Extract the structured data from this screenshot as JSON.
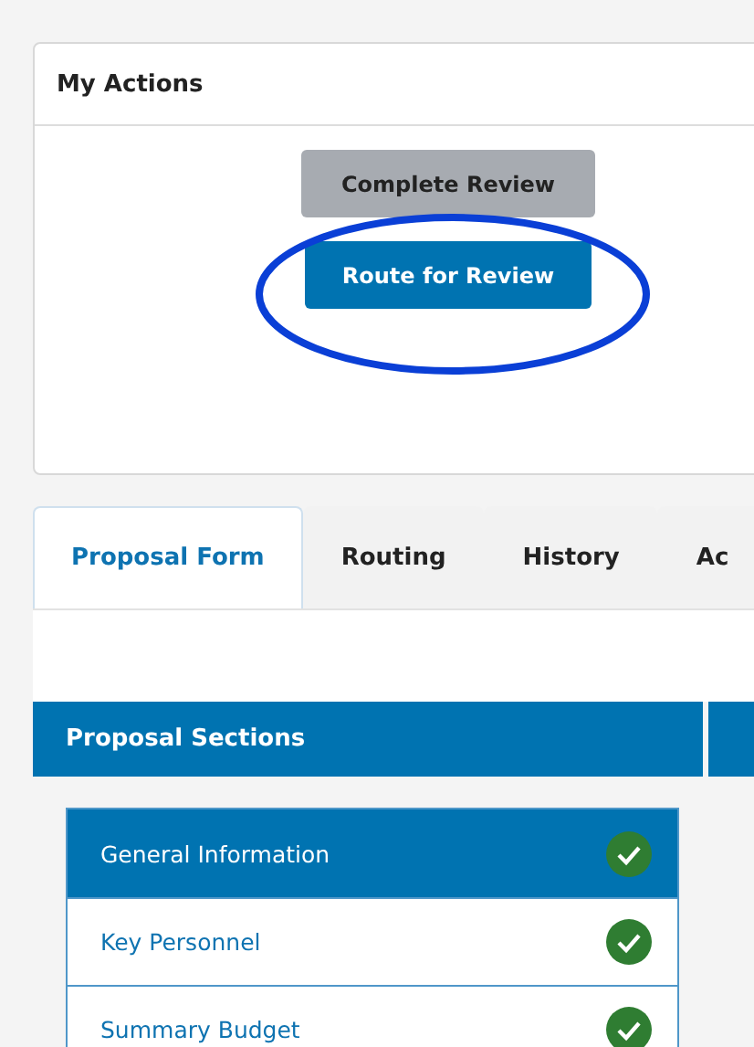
{
  "actions": {
    "title": "My Actions",
    "buttons": [
      {
        "label": "Complete Review",
        "kind": "secondary",
        "highlighted": false
      },
      {
        "label": "Route for Review",
        "kind": "primary",
        "highlighted": true
      }
    ]
  },
  "tabs": [
    {
      "label": "Proposal Form",
      "selected": true
    },
    {
      "label": "Routing",
      "selected": false
    },
    {
      "label": "History",
      "selected": false
    },
    {
      "label": "Ac",
      "selected": false
    }
  ],
  "sections": {
    "title": "Proposal Sections",
    "items": [
      {
        "label": "General Information",
        "selected": true,
        "complete": true
      },
      {
        "label": "Key Personnel",
        "selected": false,
        "complete": true
      },
      {
        "label": "Summary Budget",
        "selected": false,
        "complete": true
      }
    ]
  }
}
